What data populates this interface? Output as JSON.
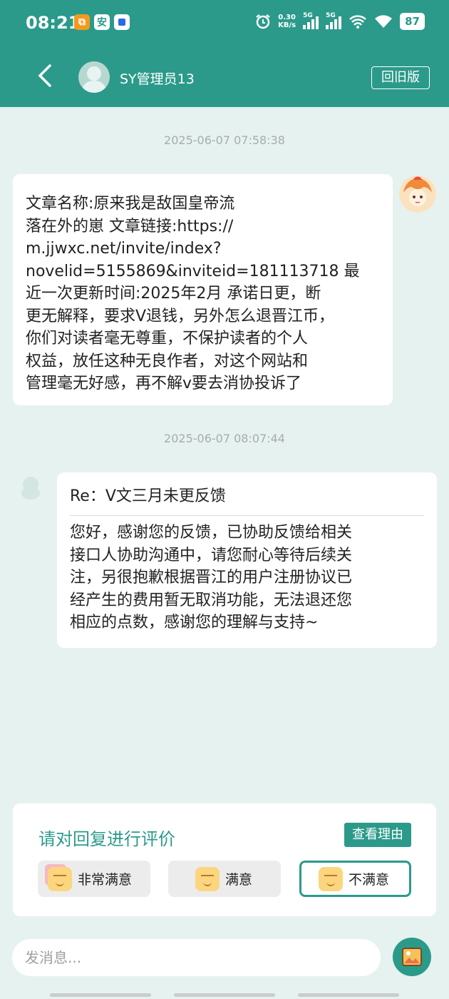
{
  "status_bar": {
    "time": "08:21",
    "net_speed_value": "0.30",
    "net_speed_unit": "KB/s",
    "signal1_label": "5G",
    "signal2_label": "5G",
    "battery": "87",
    "app_icon_2_char": "安"
  },
  "header": {
    "title": "SY管理员13",
    "old_version_label": "回旧版"
  },
  "messages": [
    {
      "timestamp": "2025-06-07 07:58:38",
      "text": "文章名称:原来我是敌国皇帝流\n落在外的崽 文章链接:https://\nm.jjwxc.net/invite/index?\nnovelid=5155869&inviteid=181113718 最\n近一次更新时间:2025年2月 承诺日更，断\n更无解释，要求V退钱，另外怎么退晋江币，\n你们对读者毫无尊重，不保护读者的个人\n权益，放任这种无良作者，对这个网站和\n管理毫无好感，再不解v要去消协投诉了"
    },
    {
      "timestamp": "2025-06-07 08:07:44",
      "subject": "Re：V文三月未更反馈",
      "text": "您好，感谢您的反馈，已协助反馈给相关\n接口人协助沟通中，请您耐心等待后续关\n注，另很抱歉根据晋江的用户注册协议已\n经产生的费用暂无取消功能，无法退还您\n相应的点数，感谢您的理解与支持~"
    }
  ],
  "rating": {
    "title": "请对回复进行评价",
    "reason_button": "查看理由",
    "options": [
      "非常满意",
      "满意",
      "不满意"
    ],
    "selected": "不满意",
    "accent_color": "#2b9a8a"
  },
  "composer": {
    "placeholder": "发消息..."
  }
}
